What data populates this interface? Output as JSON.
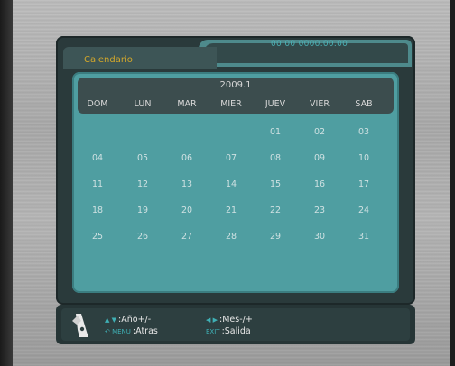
{
  "header": {
    "title": "Calendario",
    "clock": "00:00 0000.00.00"
  },
  "calendar": {
    "year_month": "2009.1",
    "weekdays": [
      "DOM",
      "LUN",
      "MAR",
      "MIER",
      "JUEV",
      "VIER",
      "SAB"
    ],
    "days": [
      [
        "",
        "",
        "",
        "",
        "01",
        "02",
        "03"
      ],
      [
        "04",
        "05",
        "06",
        "07",
        "08",
        "09",
        "10"
      ],
      [
        "11",
        "12",
        "13",
        "14",
        "15",
        "16",
        "17"
      ],
      [
        "18",
        "19",
        "20",
        "21",
        "22",
        "23",
        "24"
      ],
      [
        "25",
        "26",
        "27",
        "28",
        "29",
        "30",
        "31"
      ]
    ]
  },
  "footer": {
    "help": [
      {
        "keys": "▲ ▼",
        "label": ":Año+/-"
      },
      {
        "keys": "◀ ▶",
        "label": ":Mes-/+"
      },
      {
        "keys": "↶ MENU",
        "label": ":Atras"
      },
      {
        "keys": "EXIT",
        "label": ":Salida"
      }
    ]
  },
  "colors": {
    "title": "#d4a82a",
    "clock": "#4cb2b6",
    "calendar_bg": "#4f9ea1",
    "panel_bg": "#2a3a3b"
  },
  "icons": {
    "footer": "remote-control-icon"
  }
}
